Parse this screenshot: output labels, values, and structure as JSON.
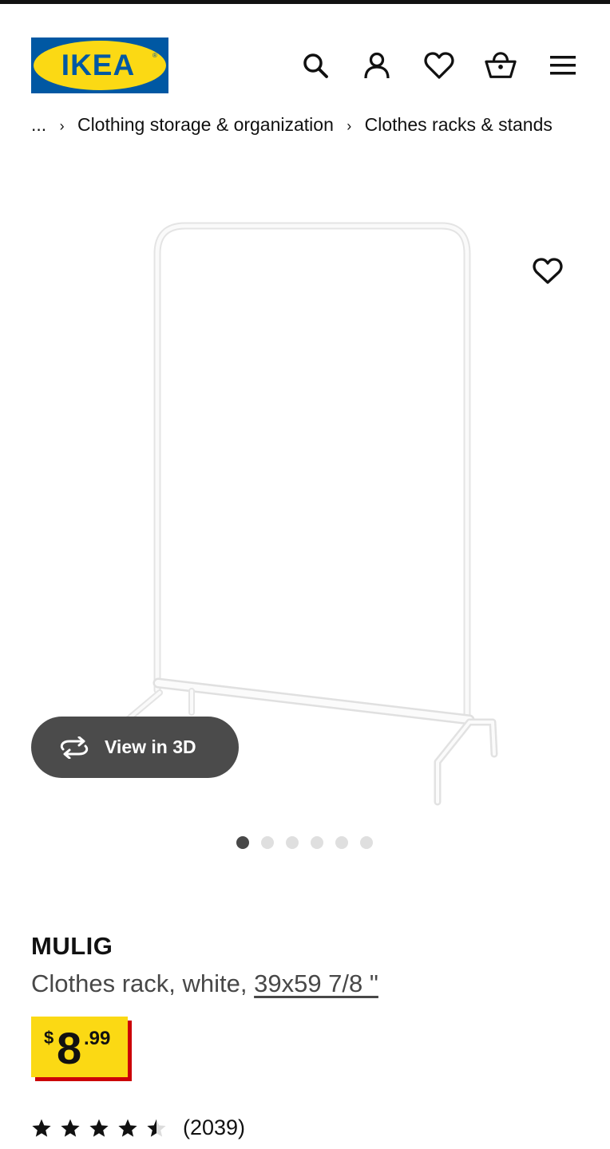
{
  "header": {
    "logo_text": "IKEA",
    "icons": [
      "search-icon",
      "account-icon",
      "favorites-icon",
      "cart-icon",
      "menu-icon"
    ]
  },
  "breadcrumb": {
    "ellipsis": "...",
    "items": [
      "Clothing storage & organization",
      "Clothes racks & stands"
    ]
  },
  "gallery": {
    "view_3d_label": "View in 3D",
    "image_count": 6,
    "active_index": 0
  },
  "product": {
    "name": "MULIG",
    "description_prefix": "Clothes rack, white, ",
    "size": "39x59 7/8 \"",
    "price": {
      "currency": "$",
      "integer": "8",
      "decimal": ".99"
    },
    "rating": {
      "stars": 4.5,
      "count": "(2039)"
    }
  },
  "colors": {
    "ikea_blue": "#0058a3",
    "ikea_yellow": "#fbd914",
    "price_shadow_red": "#cc0008",
    "view3d_bg": "#4b4b4b"
  }
}
